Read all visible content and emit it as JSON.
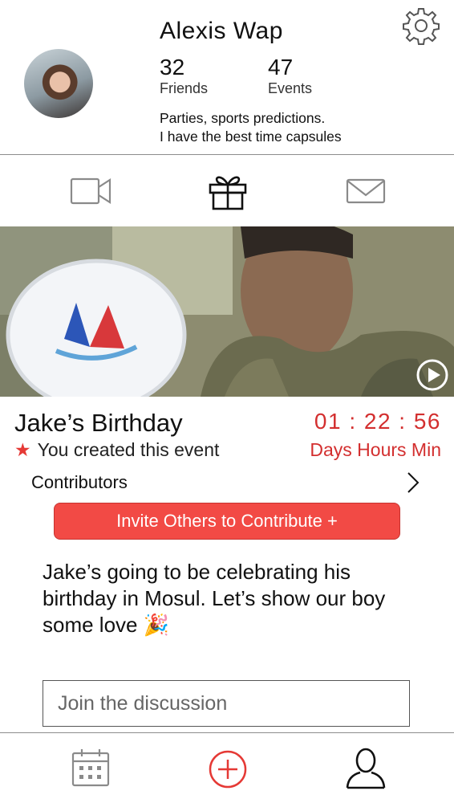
{
  "profile": {
    "name": "Alexis Wap",
    "friends_count": "32",
    "friends_label": "Friends",
    "events_count": "47",
    "events_label": "Events",
    "bio_line1": "Parties, sports predictions.",
    "bio_line2": "I have the best time capsules"
  },
  "icons": {
    "settings": "gear-icon",
    "tab_video": "video-camera-icon",
    "tab_gift": "gift-icon",
    "tab_mail": "mail-icon",
    "play": "play-icon",
    "star": "star-icon",
    "chevron": "chevron-right-icon",
    "nav_calendar": "calendar-icon",
    "nav_add": "plus-circle-icon",
    "nav_profile": "user-icon"
  },
  "event": {
    "title": "Jake’s Birthday",
    "created_note": "You created this event",
    "star_glyph": "★",
    "countdown": "01 : 22 : 56",
    "countdown_units": "Days Hours Min",
    "contributors_label": "Contributors",
    "invite_label": "Invite Others to Contribute +",
    "description": "Jake’s going to be celebrating his birthday in Mosul. Let’s show our boy some love 🎉",
    "comment_placeholder": "Join the discussion"
  },
  "colors": {
    "accent": "#f24a45",
    "accent_text": "#d32f2f",
    "divider": "#8d8d8d"
  }
}
